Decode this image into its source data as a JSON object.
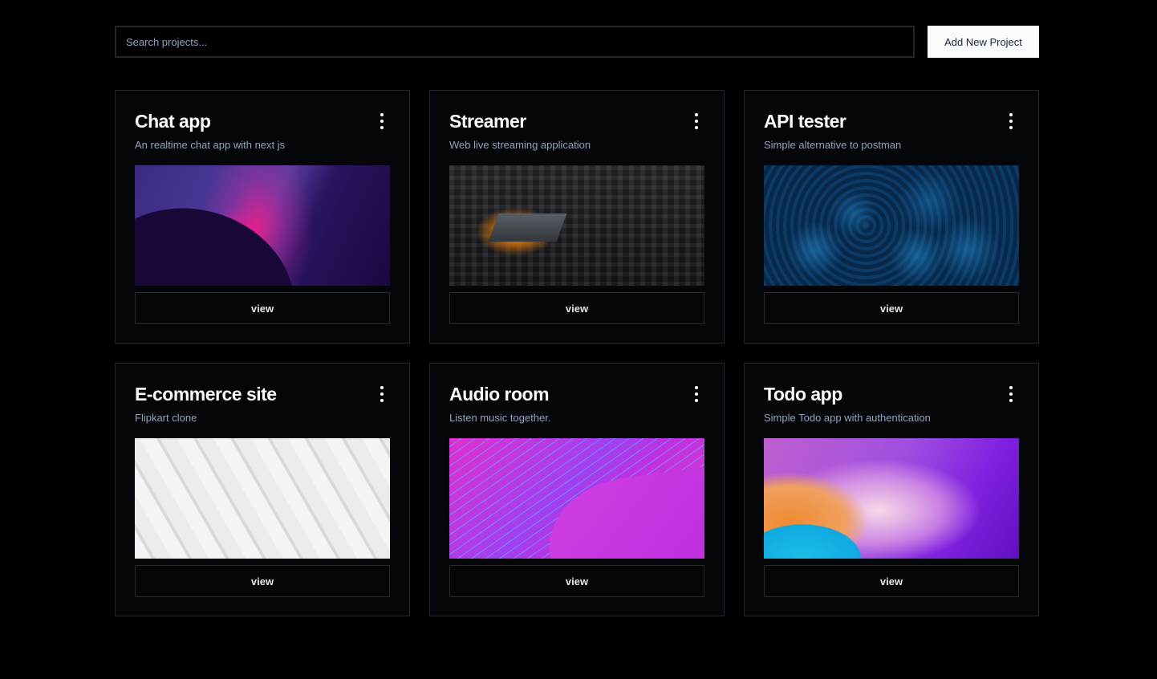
{
  "search": {
    "placeholder": "Search projects...",
    "value": ""
  },
  "toolbar": {
    "add_label": "Add New Project"
  },
  "projects": [
    {
      "title": "Chat app",
      "description": "An realtime chat app with next js",
      "thumbnail": "abstract-purple-pink-wave",
      "action_label": "view"
    },
    {
      "title": "Streamer",
      "description": "Web live streaming application",
      "thumbnail": "glowing-circuit-chip",
      "action_label": "view"
    },
    {
      "title": "API tester",
      "description": "Simple alternative to postman",
      "thumbnail": "blue-fluid-marble",
      "action_label": "view"
    },
    {
      "title": "E-commerce site",
      "description": "Flipkart clone",
      "thumbnail": "white-woven-pattern",
      "action_label": "view"
    },
    {
      "title": "Audio room",
      "description": "Listen music together.",
      "thumbnail": "magenta-string-lines",
      "action_label": "view"
    },
    {
      "title": "Todo app",
      "description": "Simple Todo app with authentication",
      "thumbnail": "gradient-orange-purple-waves",
      "action_label": "view"
    }
  ],
  "icons": {
    "card_menu": "more-vertical-icon"
  },
  "colors": {
    "background": "#000000",
    "card": "#05060a",
    "border": "#27272a",
    "primary_button": "#f8fafc",
    "muted_text": "#94a3b8"
  }
}
